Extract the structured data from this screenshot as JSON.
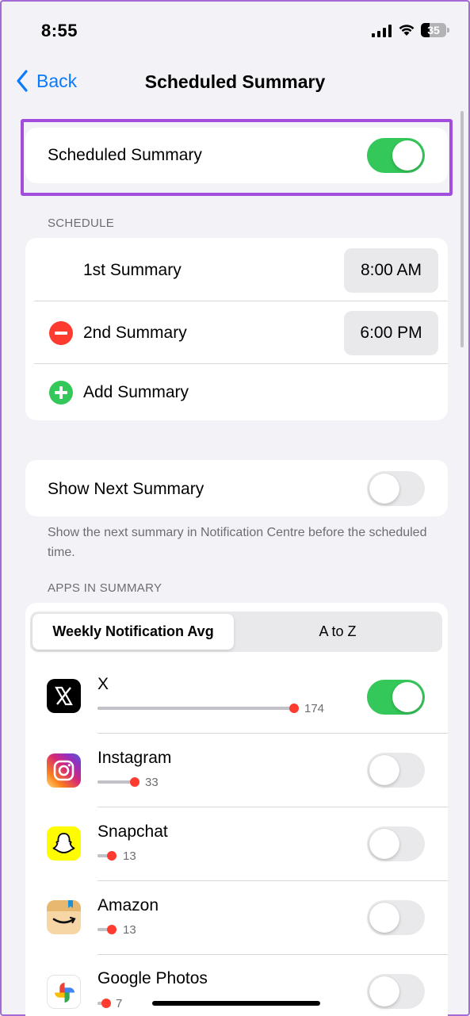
{
  "status_bar": {
    "time": "8:55",
    "battery_level": "35"
  },
  "nav": {
    "back_label": "Back",
    "title": "Scheduled Summary"
  },
  "scheduled_summary": {
    "label": "Scheduled Summary",
    "enabled": true
  },
  "schedule": {
    "header": "SCHEDULE",
    "items": [
      {
        "label": "1st Summary",
        "time": "8:00 AM"
      },
      {
        "label": "2nd Summary",
        "time": "6:00 PM"
      }
    ],
    "add_label": "Add Summary"
  },
  "show_next": {
    "label": "Show Next Summary",
    "enabled": false,
    "footnote": "Show the next summary in Notification Centre before the scheduled time."
  },
  "apps": {
    "header": "APPS IN SUMMARY",
    "sort_options": [
      "Weekly Notification Avg",
      "A to Z"
    ],
    "selected_sort": "Weekly Notification Avg",
    "list": [
      {
        "name": "X",
        "count": "174",
        "enabled": true,
        "icon": "x-app-icon"
      },
      {
        "name": "Instagram",
        "count": "33",
        "enabled": false,
        "icon": "instagram-app-icon"
      },
      {
        "name": "Snapchat",
        "count": "13",
        "enabled": false,
        "icon": "snapchat-app-icon"
      },
      {
        "name": "Amazon",
        "count": "13",
        "enabled": false,
        "icon": "amazon-app-icon"
      },
      {
        "name": "Google Photos",
        "count": "7",
        "enabled": false,
        "icon": "google-photos-app-icon"
      }
    ]
  },
  "colors": {
    "accent": "#0a7aff",
    "toggle_on": "#34c759",
    "destructive": "#ff3b30",
    "highlight": "#a24edc"
  }
}
